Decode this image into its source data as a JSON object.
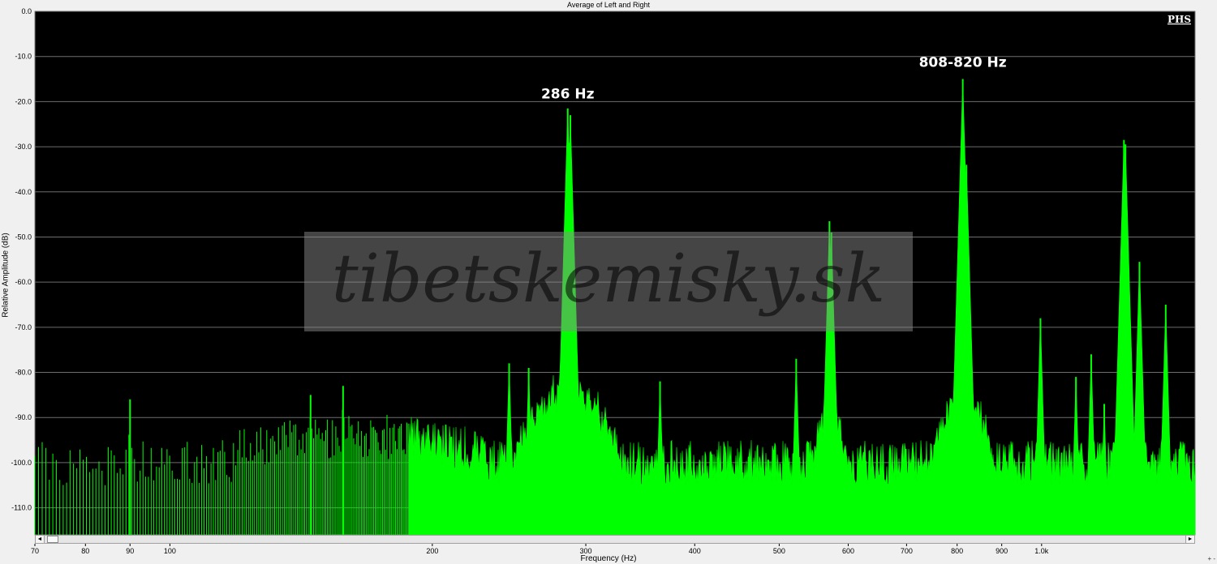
{
  "chart_data": {
    "type": "area",
    "title": "Average of Left and Right",
    "xlabel": "Frequency (Hz)",
    "ylabel": "Relative Amplitude (dB)",
    "x_scale": "log",
    "xlim": [
      70,
      1500
    ],
    "ylim": [
      -116,
      0
    ],
    "x_ticks": [
      {
        "value": 70,
        "label": "70"
      },
      {
        "value": 80,
        "label": "80"
      },
      {
        "value": 90,
        "label": "90"
      },
      {
        "value": 100,
        "label": "100"
      },
      {
        "value": 200,
        "label": "200"
      },
      {
        "value": 300,
        "label": "300"
      },
      {
        "value": 400,
        "label": "400"
      },
      {
        "value": 500,
        "label": "500"
      },
      {
        "value": 600,
        "label": "600"
      },
      {
        "value": 700,
        "label": "700"
      },
      {
        "value": 800,
        "label": "800"
      },
      {
        "value": 900,
        "label": "900"
      },
      {
        "value": 1000,
        "label": "1.0k"
      }
    ],
    "y_ticks": [
      {
        "value": 0,
        "label": "0.0"
      },
      {
        "value": -10,
        "label": "-10.0"
      },
      {
        "value": -20,
        "label": "-20.0"
      },
      {
        "value": -30,
        "label": "-30.0"
      },
      {
        "value": -40,
        "label": "-40.0"
      },
      {
        "value": -50,
        "label": "-50.0"
      },
      {
        "value": -60,
        "label": "-60.0"
      },
      {
        "value": -70,
        "label": "-70.0"
      },
      {
        "value": -80,
        "label": "-80.0"
      },
      {
        "value": -90,
        "label": "-90.0"
      },
      {
        "value": -100,
        "label": "-100.0"
      },
      {
        "value": -110,
        "label": "-110.0"
      }
    ],
    "grid": "horizontal",
    "series": [
      {
        "color": "#00ff00",
        "baseline_db": -100,
        "peaks": [
          {
            "x": 90,
            "y": -86
          },
          {
            "x": 145,
            "y": -85
          },
          {
            "x": 158,
            "y": -83
          },
          {
            "x": 245,
            "y": -78
          },
          {
            "x": 258,
            "y": -79
          },
          {
            "x": 286,
            "y": -21.5
          },
          {
            "x": 288,
            "y": -23
          },
          {
            "x": 365,
            "y": -82
          },
          {
            "x": 523,
            "y": -77
          },
          {
            "x": 571,
            "y": -46.5
          },
          {
            "x": 574,
            "y": -49
          },
          {
            "x": 812,
            "y": -15
          },
          {
            "x": 820,
            "y": -34
          },
          {
            "x": 997,
            "y": -68
          },
          {
            "x": 1095,
            "y": -81
          },
          {
            "x": 1140,
            "y": -76
          },
          {
            "x": 1180,
            "y": -87
          },
          {
            "x": 1243,
            "y": -28.5
          },
          {
            "x": 1248,
            "y": -29.5
          },
          {
            "x": 1295,
            "y": -55.5
          },
          {
            "x": 1388,
            "y": -65
          }
        ],
        "resonance_humps": [
          {
            "x": 286,
            "y": -84,
            "width_oct": 0.22
          },
          {
            "x": 571,
            "y": -90,
            "width_oct": 0.09
          },
          {
            "x": 812,
            "y": -86,
            "width_oct": 0.14
          },
          {
            "x": 1243,
            "y": -92,
            "width_oct": 0.07
          }
        ]
      }
    ],
    "annotations": [
      {
        "text": "286 Hz",
        "x": 286,
        "y": -20
      },
      {
        "text": "808-820 Hz",
        "x": 812,
        "y": -13
      }
    ]
  },
  "watermark": "tibetskemisky.sk",
  "logo": "PHS",
  "scrollbar": {
    "left_arrow": "◄",
    "right_arrow": "►"
  },
  "zoom_controls": "+ -"
}
